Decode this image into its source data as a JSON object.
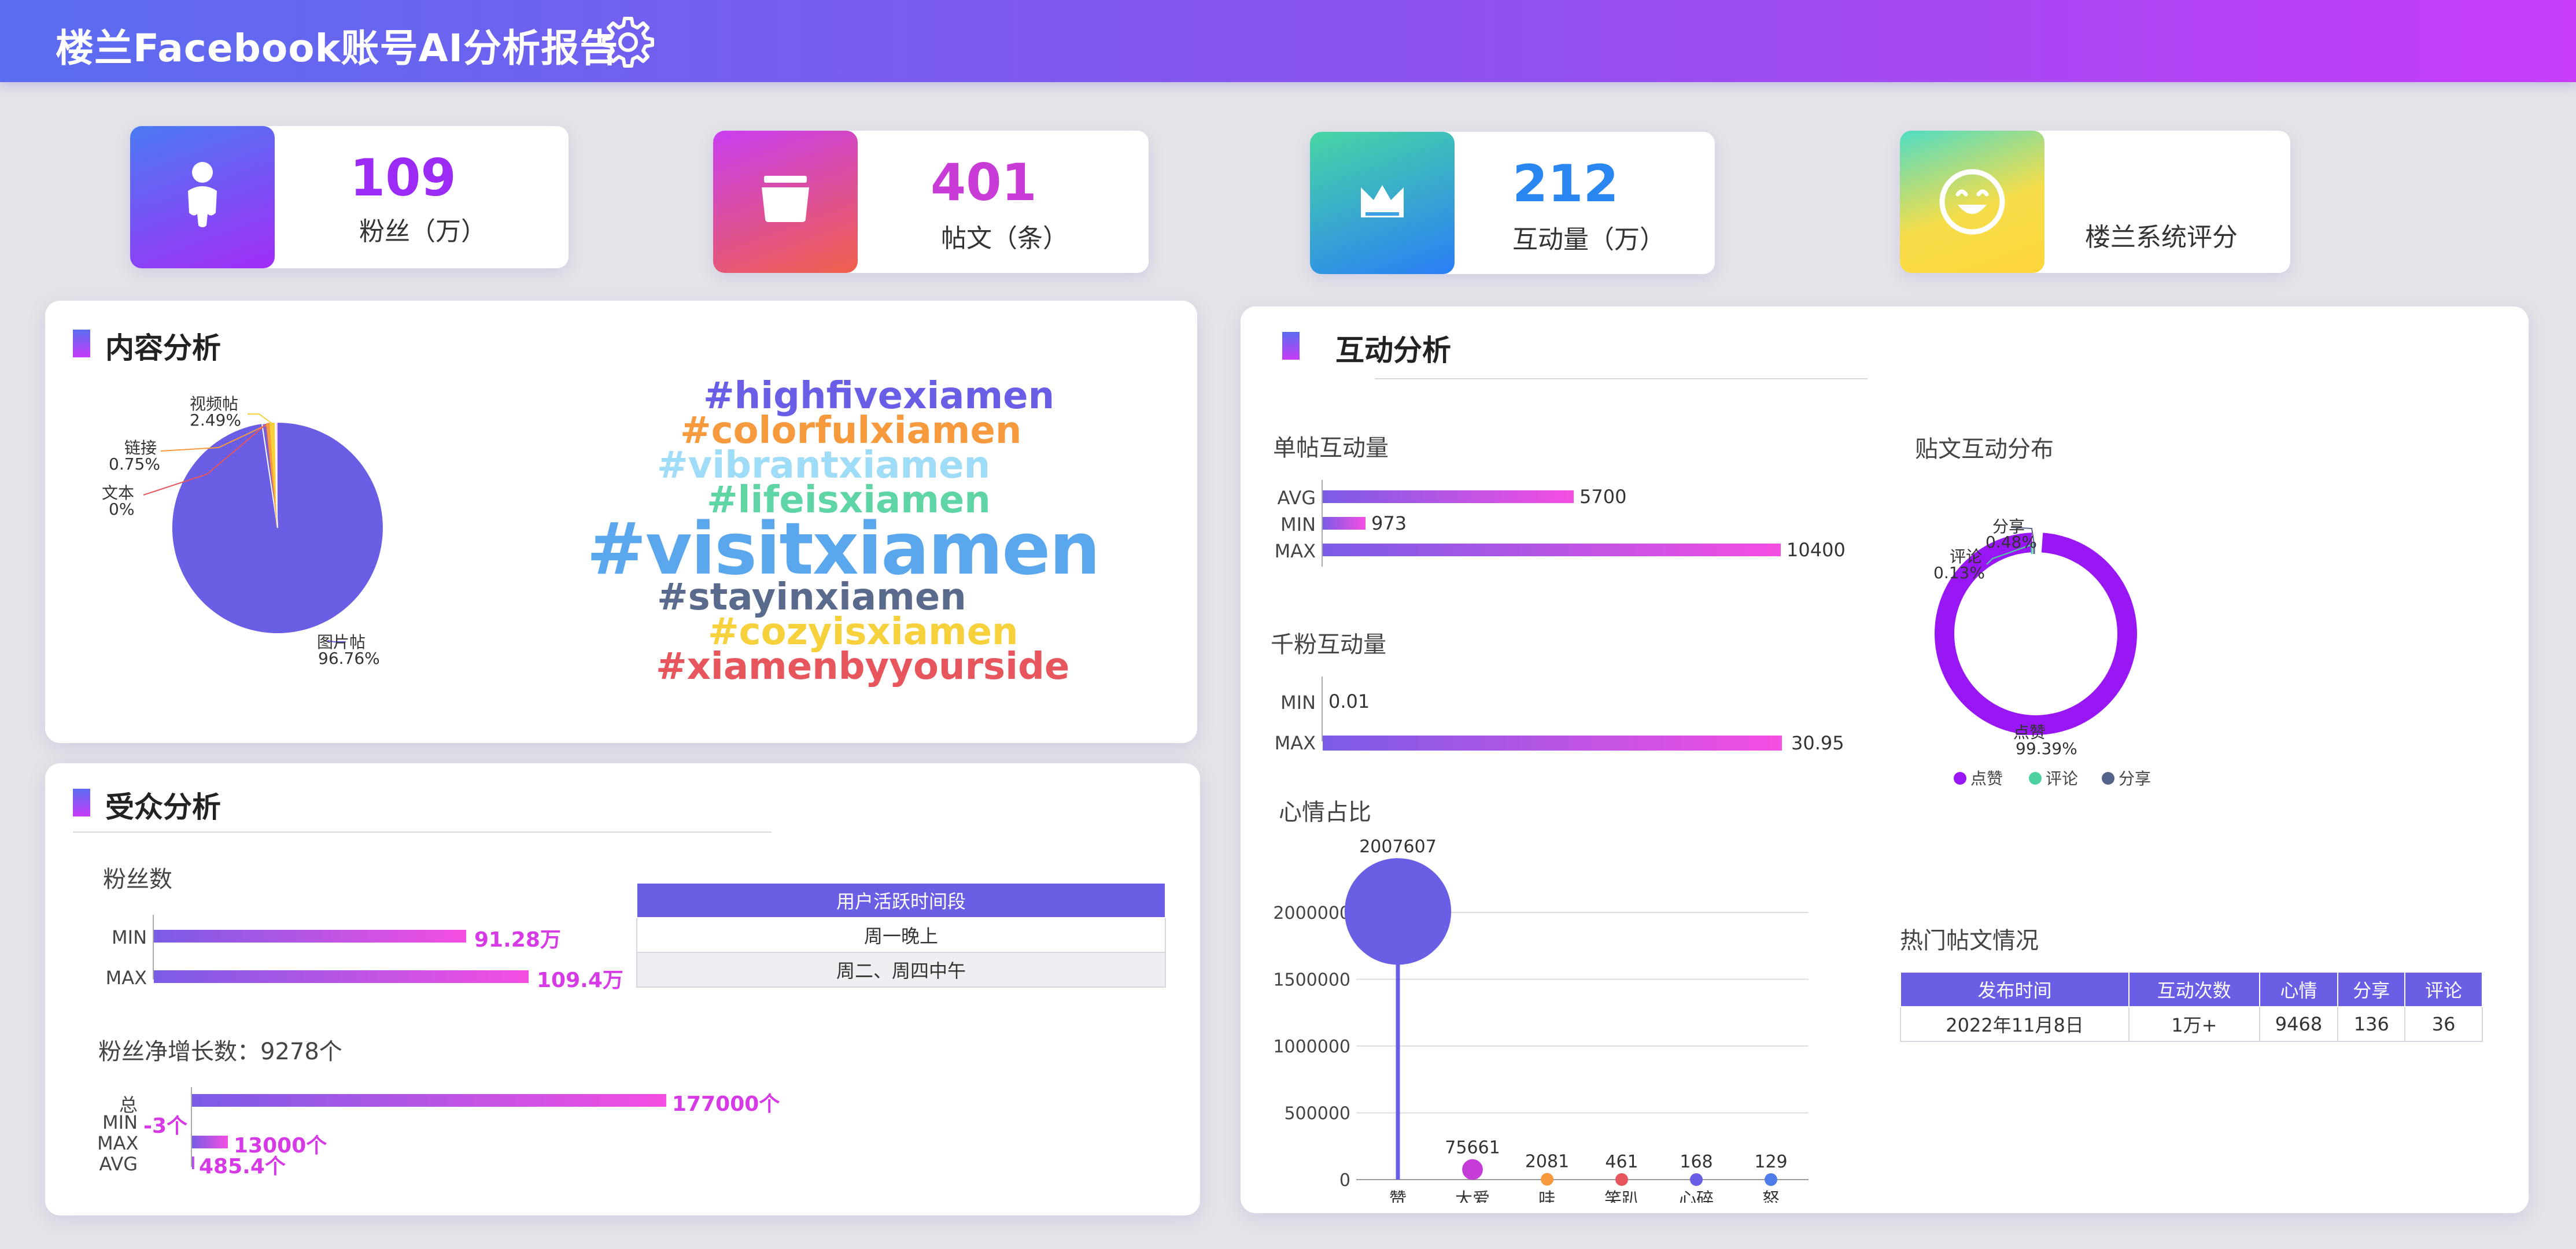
{
  "header": {
    "title": "楼兰Facebook账号AI分析报告",
    "gear_icon": "gear-icon"
  },
  "kpis": [
    {
      "value": "109",
      "label": "粉丝（万）",
      "icon": "person-icon",
      "value_color": "#9b2bf5"
    },
    {
      "value": "401",
      "label": "帖文（条）",
      "icon": "folder-icon",
      "value_color": "#c83bd6"
    },
    {
      "value": "212",
      "label": "互动量（万）",
      "icon": "crown-icon",
      "value_color": "#2a86f0"
    },
    {
      "value": "",
      "label": "楼兰系统评分",
      "icon": "smile-icon",
      "value_color": "#333333"
    }
  ],
  "content": {
    "title": "内容分析",
    "pie": {
      "type": "pie",
      "slices": [
        {
          "name": "图片帖",
          "value": 96.76,
          "label": "96.76%"
        },
        {
          "name": "视频帖",
          "value": 2.49,
          "label": "2.49%"
        },
        {
          "name": "链接",
          "value": 0.75,
          "label": "0.75%"
        },
        {
          "name": "文本",
          "value": 0,
          "label": "0%"
        }
      ]
    },
    "wordcloud": [
      {
        "text": "#highfivexiamen",
        "color": "#6b5ee6"
      },
      {
        "text": "#colorfulxiamen",
        "color": "#f79a3e"
      },
      {
        "text": "#vibrantxiamen",
        "color": "#9edcf7"
      },
      {
        "text": "#lifeisxiamen",
        "color": "#5fd4a4"
      },
      {
        "text": "#visitxiamen",
        "color": "#5aa7ee"
      },
      {
        "text": "#stayinxiamen",
        "color": "#5a6a8c"
      },
      {
        "text": "#cozyisxiamen",
        "color": "#f7d13c"
      },
      {
        "text": "#xiamenbyyourside",
        "color": "#e7555d"
      }
    ]
  },
  "audience": {
    "title": "受众分析",
    "fans_title": "粉丝数",
    "fans": [
      {
        "label": "MIN",
        "value": 91.28,
        "text": "91.28万"
      },
      {
        "label": "MAX",
        "value": 109.4,
        "text": "109.4万"
      }
    ],
    "active_table": {
      "header": "用户活跃时间段",
      "rows": [
        "周一晚上",
        "周二、周四中午"
      ]
    },
    "growth_title": "粉丝净增长数：9278个",
    "growth": [
      {
        "label": "总",
        "value": 177000,
        "text": "177000个"
      },
      {
        "label": "MIN",
        "value": -3,
        "text": "-3个"
      },
      {
        "label": "MAX",
        "value": 13000,
        "text": "13000个"
      },
      {
        "label": "AVG",
        "value": 485.4,
        "text": "485.4个"
      }
    ]
  },
  "interaction": {
    "title": "互动分析",
    "single_title": "单帖互动量",
    "single": [
      {
        "label": "AVG",
        "value": 5700,
        "text": "5700"
      },
      {
        "label": "MIN",
        "value": 973,
        "text": "973"
      },
      {
        "label": "MAX",
        "value": 10400,
        "text": "10400"
      }
    ],
    "per_k_title": "千粉互动量",
    "per_k": [
      {
        "label": "MIN",
        "value": 0.01,
        "text": "0.01"
      },
      {
        "label": "MAX",
        "value": 30.95,
        "text": "30.95"
      }
    ],
    "dist_title": "贴文互动分布",
    "donut": {
      "type": "pie",
      "slices": [
        {
          "name": "点赞",
          "value": 99.39,
          "label": "99.39%",
          "color": "#9a17f5"
        },
        {
          "name": "评论",
          "value": 0.13,
          "label": "0.13%",
          "color": "#4ed1a0"
        },
        {
          "name": "分享",
          "value": 0.48,
          "label": "0.48%",
          "color": "#55638a"
        }
      ],
      "legend": [
        "点赞",
        "评论",
        "分享"
      ]
    },
    "mood_title": "心情占比",
    "chart_data": {
      "type": "scatter",
      "categories": [
        "赞",
        "大爱",
        "哇",
        "笑趴",
        "心碎",
        "怒"
      ],
      "values": [
        2007607,
        75661,
        2081,
        461,
        168,
        129
      ],
      "colors": [
        "#6a5fe4",
        "#c43bd8",
        "#f79a3e",
        "#e7555d",
        "#6a5fe4",
        "#4d7de8"
      ],
      "yticks": [
        0,
        500000,
        1000000,
        1500000,
        2000000
      ],
      "ylim": [
        0,
        2000000
      ]
    },
    "hot_title": "热门帖文情况",
    "hot_table": {
      "headers": [
        "发布时间",
        "互动次数",
        "心情",
        "分享",
        "评论"
      ],
      "rows": [
        [
          "2022年11月8日",
          "1万+",
          "9468",
          "136",
          "36"
        ]
      ]
    }
  }
}
